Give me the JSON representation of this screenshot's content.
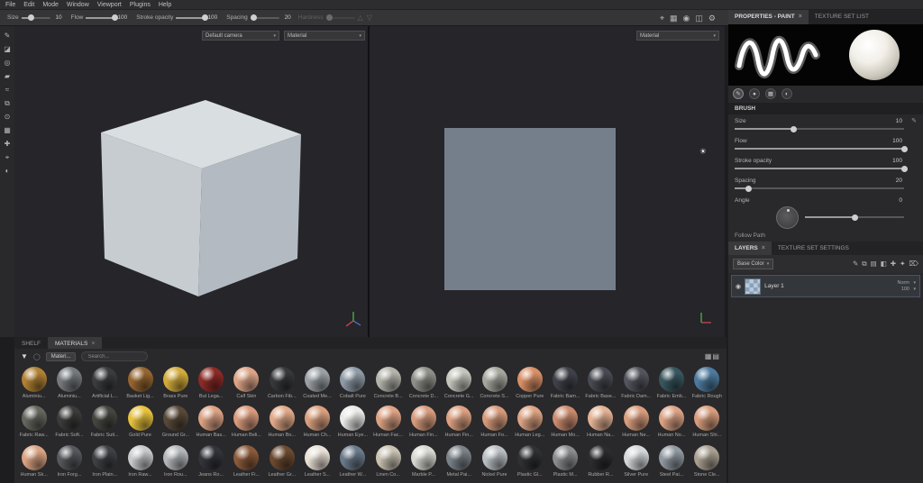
{
  "ui": {
    "caret": "▾",
    "close": "×",
    "sun": "☀",
    "eye": "◉"
  },
  "menubar": {
    "items": [
      "File",
      "Edit",
      "Mode",
      "Window",
      "Viewport",
      "Plugins",
      "Help"
    ]
  },
  "toolbar": {
    "sliders": [
      {
        "label": "Size",
        "value": "10",
        "pct": 35
      },
      {
        "label": "Flow",
        "value": "100",
        "pct": 100
      },
      {
        "label": "Stroke opacity",
        "value": "100",
        "pct": 100
      },
      {
        "label": "Spacing",
        "value": "20",
        "pct": 10
      }
    ],
    "disabled_label": "Hardness",
    "disabled_icons": [
      {
        "name": "align-up-icon",
        "glyph": "△"
      },
      {
        "name": "align-down-icon",
        "glyph": "▽"
      }
    ],
    "right_icons": [
      {
        "name": "symmetry-icon",
        "glyph": "⌖"
      },
      {
        "name": "tablet-pressure-icon",
        "glyph": "▦"
      },
      {
        "name": "camera-icon",
        "glyph": "◉"
      },
      {
        "name": "viewport-layout-icon",
        "glyph": "◫"
      },
      {
        "name": "settings-icon",
        "glyph": "⚙"
      }
    ]
  },
  "left_tools": [
    {
      "name": "paint-tool",
      "glyph": "✎"
    },
    {
      "name": "eraser-tool",
      "glyph": "◪"
    },
    {
      "name": "projection-tool",
      "glyph": "◎"
    },
    {
      "name": "polygon-fill-tool",
      "glyph": "▰"
    },
    {
      "name": "smudge-tool",
      "glyph": "≈"
    },
    {
      "name": "clone-tool",
      "glyph": "⧉"
    },
    {
      "name": "material-picker-tool",
      "glyph": "⊙"
    },
    {
      "name": "geometry-mask-tool",
      "glyph": "▦"
    },
    {
      "name": "path-tool",
      "glyph": "✚"
    },
    {
      "name": "symmetry-tool",
      "glyph": "⌖"
    },
    {
      "name": "display-settings-tool",
      "glyph": "◐"
    }
  ],
  "viewport": {
    "camera_dropdown": "Default camera",
    "material_dropdown_3d": "Material",
    "material_dropdown_2d": "Material"
  },
  "properties": {
    "tab_active": "PROPERTIES - PAINT",
    "tab_inactive": "TEXTURE SET LIST",
    "section": "BRUSH",
    "sliders": [
      {
        "label": "Size",
        "value": "10",
        "pct": 35,
        "edit": true
      },
      {
        "label": "Flow",
        "value": "100",
        "pct": 100
      },
      {
        "label": "Stroke opacity",
        "value": "100",
        "pct": 100
      },
      {
        "label": "Spacing",
        "value": "20",
        "pct": 8
      },
      {
        "label": "Angle",
        "value": "0",
        "pct": 50,
        "dial": true
      }
    ],
    "follow_path": "Follow Path",
    "toolmodes": [
      {
        "name": "brush-mode-icon",
        "glyph": "✎",
        "active": true
      },
      {
        "name": "particles-mode-icon",
        "glyph": "●"
      },
      {
        "name": "material-mode-icon",
        "glyph": "▦"
      },
      {
        "name": "stencil-mode-icon",
        "glyph": "◐"
      }
    ]
  },
  "layers": {
    "tab_active": "LAYERS",
    "tab_inactive": "TEXTURE SET SETTINGS",
    "channel": "Base Color",
    "toolbar_icons": [
      {
        "name": "edit-icon",
        "glyph": "✎"
      },
      {
        "name": "instance-icon",
        "glyph": "⧉"
      },
      {
        "name": "add-folder-icon",
        "glyph": "▤"
      },
      {
        "name": "add-fill-layer-icon",
        "glyph": "◧"
      },
      {
        "name": "add-layer-icon",
        "glyph": "✚"
      },
      {
        "name": "add-smart-material-icon",
        "glyph": "✦"
      },
      {
        "name": "delete-layer-icon",
        "glyph": "⌦"
      }
    ],
    "layer": {
      "name": "Layer 1",
      "blend": "Norm",
      "opacity": "100"
    }
  },
  "shelf": {
    "tab_shelf": "SHELF",
    "tab_materials": "MATERIALS",
    "breadcrumb": "Materi...",
    "search_placeholder": "Search...",
    "materials": [
      {
        "n": "Aluminiu...",
        "c": "#b08034"
      },
      {
        "n": "Aluminiu...",
        "c": "#75797d"
      },
      {
        "n": "Artificial L...",
        "c": "#3a3c3e"
      },
      {
        "n": "Basket Lig...",
        "c": "#95652f"
      },
      {
        "n": "Brass Pure",
        "c": "#d2ab3c"
      },
      {
        "n": "But Lega...",
        "c": "#8c2a26"
      },
      {
        "n": "Calf Skin",
        "c": "#dca487"
      },
      {
        "n": "Carbon Fib...",
        "c": "#36383a"
      },
      {
        "n": "Coated Me...",
        "c": "#9aa0a5"
      },
      {
        "n": "Cobalt Pure",
        "c": "#8e9aa6"
      },
      {
        "n": "Concrete B...",
        "c": "#b3b3ab"
      },
      {
        "n": "Concrete D...",
        "c": "#8e8f87"
      },
      {
        "n": "Concrete G...",
        "c": "#c4c4bc"
      },
      {
        "n": "Concrete S...",
        "c": "#a6a69e"
      },
      {
        "n": "Copper Pure",
        "c": "#d88f66"
      },
      {
        "n": "Fabric Bam...",
        "c": "#3f4149"
      },
      {
        "n": "Fabric Base...",
        "c": "#484a52"
      },
      {
        "n": "Fabric Dam...",
        "c": "#53555d"
      },
      {
        "n": "Fabric Emb...",
        "c": "#39565f"
      },
      {
        "n": "Fabric Rough",
        "c": "#4d7a9e"
      },
      {
        "n": "Fabric Raw...",
        "c": "#66665f"
      },
      {
        "n": "Fabric Soft...",
        "c": "#3b3b39"
      },
      {
        "n": "Fabric Suit...",
        "c": "#454540"
      },
      {
        "n": "Gold Pure",
        "c": "#e6c13d"
      },
      {
        "n": "Ground Gr...",
        "c": "#584838"
      },
      {
        "n": "Human Bas...",
        "c": "#dba183"
      },
      {
        "n": "Human Beli...",
        "c": "#d89a7c"
      },
      {
        "n": "Human Bo...",
        "c": "#e0a988"
      },
      {
        "n": "Human Ch...",
        "c": "#d9a07f"
      },
      {
        "n": "Human Eye...",
        "c": "#e9e9e7"
      },
      {
        "n": "Human Fac...",
        "c": "#dda284"
      },
      {
        "n": "Human Fin...",
        "c": "#d79b7d"
      },
      {
        "n": "Human Fin...",
        "c": "#dba081"
      },
      {
        "n": "Human Fo...",
        "c": "#d59a7b"
      },
      {
        "n": "Human Leg...",
        "c": "#dca383"
      },
      {
        "n": "Human Mo...",
        "c": "#c98a6e"
      },
      {
        "n": "Human Na...",
        "c": "#e3b294"
      },
      {
        "n": "Human Ne...",
        "c": "#d89d7e"
      },
      {
        "n": "Human No...",
        "c": "#dba285"
      },
      {
        "n": "Human Shi...",
        "c": "#d69c7d"
      },
      {
        "n": "Human Sk...",
        "c": "#d9a382"
      },
      {
        "n": "Iron Forg...",
        "c": "#55585c"
      },
      {
        "n": "Iron Plain...",
        "c": "#3e4044"
      },
      {
        "n": "Iron Raw...",
        "c": "#c7cacd"
      },
      {
        "n": "Iron Rou...",
        "c": "#b3b6ba"
      },
      {
        "n": "Jeans Ro...",
        "c": "#32343a"
      },
      {
        "n": "Leather Fi...",
        "c": "#8a5a3a"
      },
      {
        "n": "Leather Gr...",
        "c": "#6b4a30"
      },
      {
        "n": "Leather S...",
        "c": "#e8e0d6"
      },
      {
        "n": "Leather W...",
        "c": "#6a7a8a"
      },
      {
        "n": "Linen Co...",
        "c": "#c9c2b2"
      },
      {
        "n": "Marble P...",
        "c": "#d8d8d2"
      },
      {
        "n": "Metal Pai...",
        "c": "#7a8288"
      },
      {
        "n": "Nickel Pure",
        "c": "#b9bec2"
      },
      {
        "n": "Plastic Gl...",
        "c": "#2f3134"
      },
      {
        "n": "Plastic M...",
        "c": "#8a8d90"
      },
      {
        "n": "Rubber R...",
        "c": "#2c2c2e"
      },
      {
        "n": "Silver Pure",
        "c": "#d4d8db"
      },
      {
        "n": "Steel Pai...",
        "c": "#9099a0"
      },
      {
        "n": "Stone Cle...",
        "c": "#a89f90"
      }
    ]
  },
  "colors": {
    "uv_plane": "#747f8b",
    "cube_top": "#d9dee1",
    "cube_left": "#c6ccd0",
    "cube_right": "#b3bac1"
  }
}
